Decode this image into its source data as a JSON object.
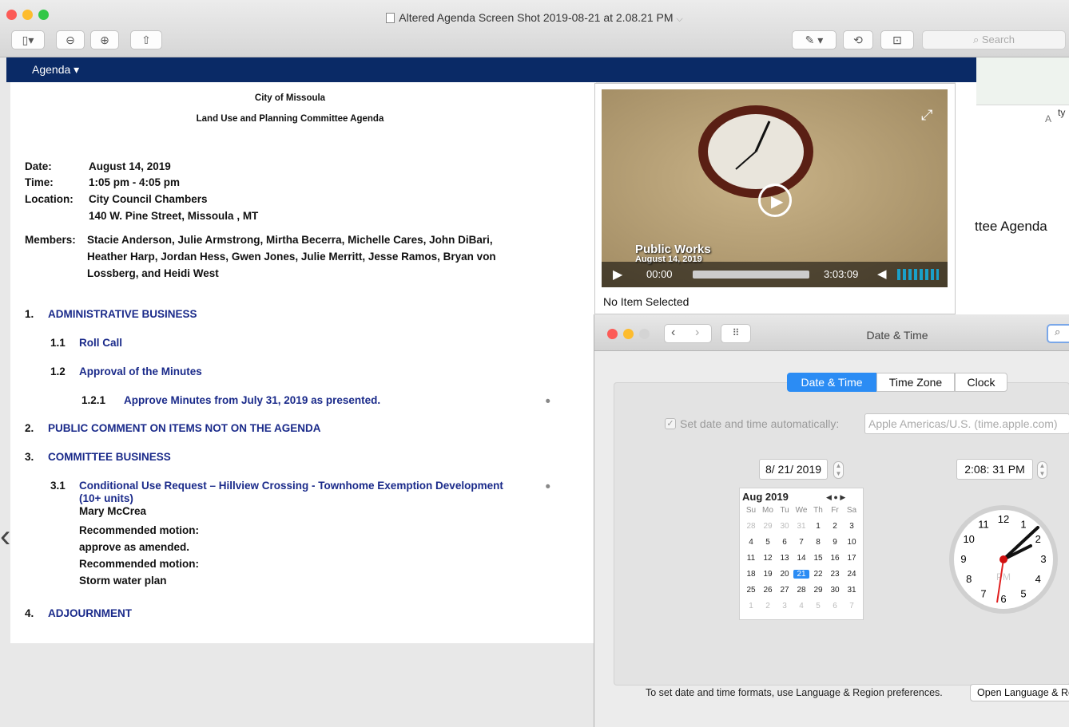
{
  "window": {
    "title": "Altered Agenda Screen Shot 2019-08-21 at 2.08.21 PM",
    "search_placeholder": "Search"
  },
  "navbar": {
    "menu": "Agenda ▾"
  },
  "doc": {
    "org": "City of Missoula",
    "title": "Land Use and Planning Committee Agenda",
    "date_label": "Date:",
    "date": "August 14, 2019",
    "time_label": "Time:",
    "time": "1:05 pm - 4:05 pm",
    "location_label": "Location:",
    "location1": "City Council Chambers",
    "location2": "140 W. Pine Street, Missoula , MT",
    "members_label": "Members:",
    "members1": "Stacie Anderson, Julie Armstrong, Mirtha Becerra, Michelle Cares, John DiBari,",
    "members2": "Heather Harp, Jordan Hess, Gwen Jones, Julie Merritt, Jesse Ramos, Bryan von",
    "members3": "Lossberg, and Heidi West",
    "s1n": "1.",
    "s1": "ADMINISTRATIVE BUSINESS",
    "s11n": "1.1",
    "s11": "Roll Call",
    "s12n": "1.2",
    "s12": "Approval of the Minutes",
    "s121n": "1.2.1",
    "s121": "Approve Minutes from July 31, 2019 as presented.",
    "s2n": "2.",
    "s2": "PUBLIC COMMENT ON ITEMS NOT ON THE AGENDA",
    "s3n": "3.",
    "s3": "COMMITTEE BUSINESS",
    "s31n": "3.1",
    "s31a": "Conditional Use Request – Hillview Crossing - Townhome Exemption Development",
    "s31b": "(10+ units)",
    "presenter": "Mary McCrea",
    "rm1": "Recommended motion:",
    "rm1v": "approve as amended.",
    "rm2": "Recommended motion:",
    "rm2v": "Storm water plan",
    "s4n": "4.",
    "s4": "ADJOURNMENT"
  },
  "video": {
    "overlay1": "Public Works",
    "overlay2": "August 14, 2019",
    "elapsed": "00:00",
    "duration": "3:03:09",
    "caption": "No Item Selected",
    "progress": 0
  },
  "stub": {
    "text1": "ttee Agenda",
    "text2": "A",
    "text3": "ty"
  },
  "datetime": {
    "title": "Date & Time",
    "tabs": [
      "Date & Time",
      "Time Zone",
      "Clock"
    ],
    "auto_label": "Set date and time automatically:",
    "server": "Apple Americas/U.S. (time.apple.com)",
    "date_value": "8/ 21/ 2019",
    "time_value": "2:08: 31 PM",
    "cal_month": "Aug 2019",
    "cal_nav": "◀ ● ▶",
    "weekdays": [
      "Su",
      "Mo",
      "Tu",
      "We",
      "Th",
      "Fr",
      "Sa"
    ],
    "days": [
      "28",
      "29",
      "30",
      "31",
      "1",
      "2",
      "3",
      "4",
      "5",
      "6",
      "7",
      "8",
      "9",
      "10",
      "11",
      "12",
      "13",
      "14",
      "15",
      "16",
      "17",
      "18",
      "19",
      "20",
      "21",
      "22",
      "23",
      "24",
      "25",
      "26",
      "27",
      "28",
      "29",
      "30",
      "31",
      "1",
      "2",
      "3",
      "4",
      "5",
      "6",
      "7"
    ],
    "selected_day": "21",
    "clock_nums": [
      "12",
      "1",
      "2",
      "3",
      "4",
      "5",
      "6",
      "7",
      "8",
      "9",
      "10",
      "11"
    ],
    "clock_pm": "PM",
    "footer": "To set date and time formats, use Language & Region preferences.",
    "open_btn": "Open Language & Region..."
  },
  "colors": {
    "navbar": "#0a2a66",
    "link": "#1a2a8a",
    "accent": "#2b8cf4"
  }
}
